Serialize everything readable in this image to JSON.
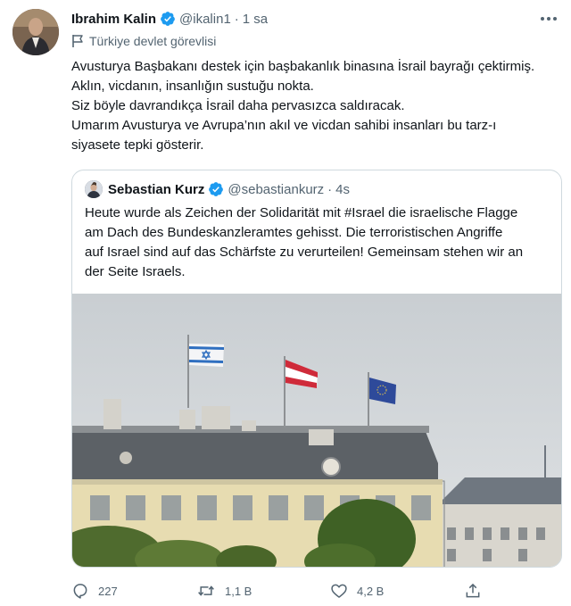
{
  "author": {
    "name": "Ibrahim Kalin",
    "handle": "@ikalin1",
    "time": "1 sa",
    "label": "Türkiye devlet görevlisi"
  },
  "tweet_lines": [
    "Avusturya Başbakanı destek için başbakanlık binasına İsrail bayrağı çektirmiş.",
    "Aklın, vicdanın, insanlığın sustuğu nokta.",
    "Siz böyle davrandıkça İsrail daha pervasızca saldıracak.",
    "Umarım Avusturya ve Avrupa’nın akıl ve vicdan sahibi insanları bu tarz-ı",
    "siyasete tepki gösterir."
  ],
  "quoted": {
    "name": "Sebastian Kurz",
    "handle": "@sebastiankurz",
    "time": "4s",
    "lines": [
      "Heute wurde als Zeichen der Solidarität mit #Israel die israelische Flagge",
      "am Dach des Bundeskanzleramtes gehisst. Die terroristischen Angriffe",
      "auf Israel sind auf das Schärfste zu verurteilen! Gemeinsam stehen wir an",
      "der Seite Israels."
    ]
  },
  "stats": {
    "replies": "227",
    "retweets": "1,1 B",
    "likes": "4,2 B"
  },
  "colors": {
    "verified": "#1d9bf0",
    "muted": "#536471",
    "border": "#cfd9de"
  }
}
